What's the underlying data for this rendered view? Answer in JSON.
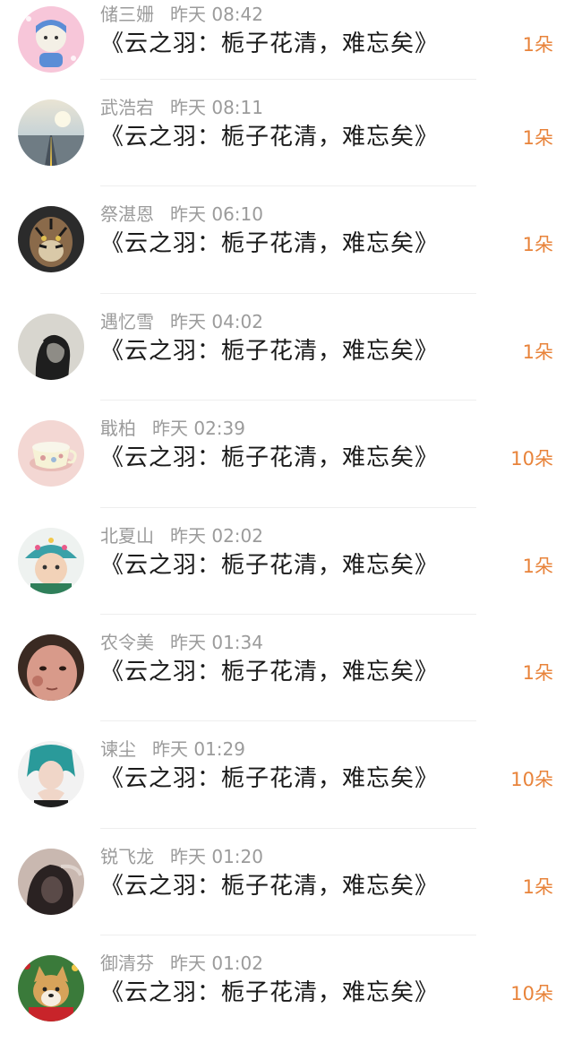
{
  "gift_list": {
    "items": [
      {
        "name": "储三姗",
        "time": "昨天 08:42",
        "title": "《云之羽：栀子花清，难忘矣》",
        "count": "1朵",
        "avatar": "avatar-cartoon-icon",
        "colors": [
          "#f7c6d9",
          "#5b8dd6",
          "#f4f0e6"
        ]
      },
      {
        "name": "武浩宕",
        "time": "昨天 08:11",
        "title": "《云之羽：栀子花清，难忘矣》",
        "count": "1朵",
        "avatar": "avatar-road-landscape-icon",
        "colors": [
          "#a9c4d8",
          "#e9e4d4",
          "#46505a"
        ]
      },
      {
        "name": "祭湛恩",
        "time": "昨天 06:10",
        "title": "《云之羽：栀子花清，难忘矣》",
        "count": "1朵",
        "avatar": "avatar-tiger-icon",
        "colors": [
          "#2b2b2b",
          "#8a6a4a",
          "#d9c9a8"
        ]
      },
      {
        "name": "遇忆雪",
        "time": "昨天 04:02",
        "title": "《云之羽：栀子花清，难忘矣》",
        "count": "1朵",
        "avatar": "avatar-dark-portrait-icon",
        "colors": [
          "#d8d6cf",
          "#1e1e1e",
          "#8e8c86"
        ]
      },
      {
        "name": "戢柏",
        "time": "昨天 02:39",
        "title": "《云之羽：栀子花清，难忘矣》",
        "count": "10朵",
        "avatar": "avatar-teacup-icon",
        "colors": [
          "#f3d7d3",
          "#f6f2d6",
          "#d99a9a"
        ]
      },
      {
        "name": "北夏山",
        "time": "昨天 02:02",
        "title": "《云之羽：栀子花清，难忘矣》",
        "count": "1朵",
        "avatar": "avatar-child-hat-icon",
        "colors": [
          "#3aa1a8",
          "#e95a8a",
          "#f2d2b8"
        ]
      },
      {
        "name": "农令美",
        "time": "昨天 01:34",
        "title": "《云之羽：栀子花清，难忘矣》",
        "count": "1朵",
        "avatar": "avatar-face-closeup-icon",
        "colors": [
          "#d89a8a",
          "#3a2a22",
          "#b5685a"
        ]
      },
      {
        "name": "谏尘",
        "time": "昨天 01:29",
        "title": "《云之羽：栀子花清，难忘矣》",
        "count": "10朵",
        "avatar": "avatar-heart-hands-icon",
        "colors": [
          "#f2f2f2",
          "#2a9a9a",
          "#1e1e1e"
        ]
      },
      {
        "name": "锐飞龙",
        "time": "昨天 01:20",
        "title": "《云之羽：栀子花清，难忘矣》",
        "count": "1朵",
        "avatar": "avatar-dim-portrait-icon",
        "colors": [
          "#5a4a48",
          "#c9b8b0",
          "#2a2222"
        ]
      },
      {
        "name": "御清芬",
        "time": "昨天 01:02",
        "title": "《云之羽：栀子花清，难忘矣》",
        "count": "10朵",
        "avatar": "avatar-shiba-dog-icon",
        "colors": [
          "#d7a35a",
          "#c8242a",
          "#3a7a3a"
        ]
      }
    ]
  }
}
